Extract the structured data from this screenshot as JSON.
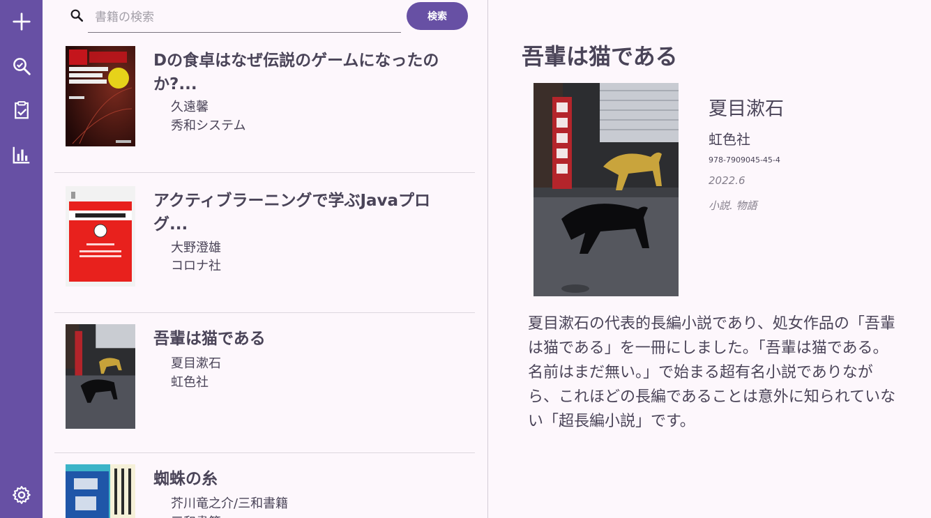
{
  "nav": {
    "items": [
      {
        "name": "add",
        "icon": "plus-icon"
      },
      {
        "name": "search",
        "icon": "zoom-search-icon"
      },
      {
        "name": "tasks",
        "icon": "clipboard-check-icon"
      },
      {
        "name": "stats",
        "icon": "bar-chart-icon"
      },
      {
        "name": "settings",
        "icon": "gear-icon"
      }
    ]
  },
  "search": {
    "placeholder": "書籍の検索",
    "value": "",
    "button_label": "検索",
    "icon": "search-icon"
  },
  "books": [
    {
      "title": "Dの食卓はなぜ伝説のゲームになったのか?...",
      "author": "久遠馨",
      "publisher": "秀和システム"
    },
    {
      "title": "アクティブラーニングで学ぶJavaプログ...",
      "author": "大野澄雄",
      "publisher": "コロナ社"
    },
    {
      "title": "吾輩は猫である",
      "author": "夏目漱石",
      "publisher": "虹色社"
    },
    {
      "title": "蜘蛛の糸",
      "author": "芥川竜之介/三和書籍",
      "publisher": "三和書籍"
    }
  ],
  "detail": {
    "title": "吾輩は猫である",
    "author": "夏目漱石",
    "publisher": "虹色社",
    "isbn": "978-7909045-45-4",
    "date": "2022.6",
    "genre": "小説. 物語",
    "description": "夏目漱石の代表的長編小説であり、処女作品の「吾輩は猫である」を一冊にしました。「吾輩は猫である。名前はまだ無い。」で始まる超有名小説でありながら、これほどの長編であることは意外に知られていない「超長編小説」です。"
  },
  "colors": {
    "primary": "#6750a4",
    "background": "#fdf7fc",
    "text": "#4a4458"
  }
}
